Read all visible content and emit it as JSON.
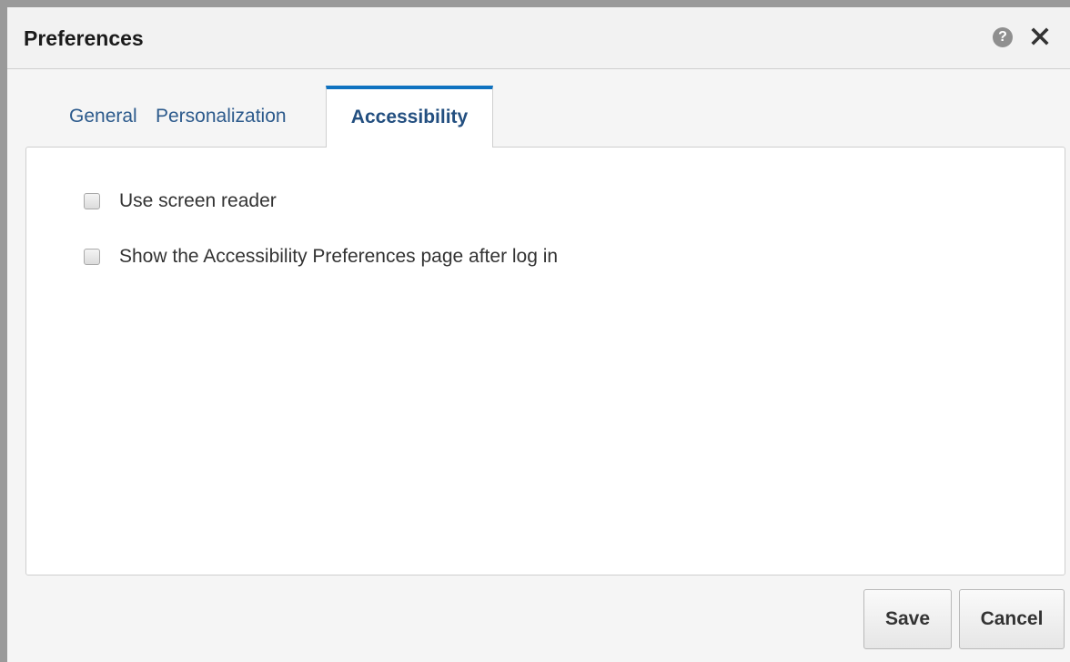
{
  "dialog": {
    "title": "Preferences",
    "help_icon": "help-icon",
    "help_glyph": "?",
    "close_icon": "close-icon"
  },
  "tabs": [
    {
      "label": "General",
      "selected": false
    },
    {
      "label": "Personalization",
      "selected": false
    },
    {
      "label": "Accessibility",
      "selected": true
    }
  ],
  "options": [
    {
      "label": "Use screen reader",
      "checked": false
    },
    {
      "label": "Show the Accessibility Preferences page after log in",
      "checked": false
    }
  ],
  "buttons": {
    "save_label": "Save",
    "cancel_label": "Cancel"
  },
  "colors": {
    "active_tab_accent": "#0f72c0",
    "tab_text": "#2c5a8c"
  }
}
